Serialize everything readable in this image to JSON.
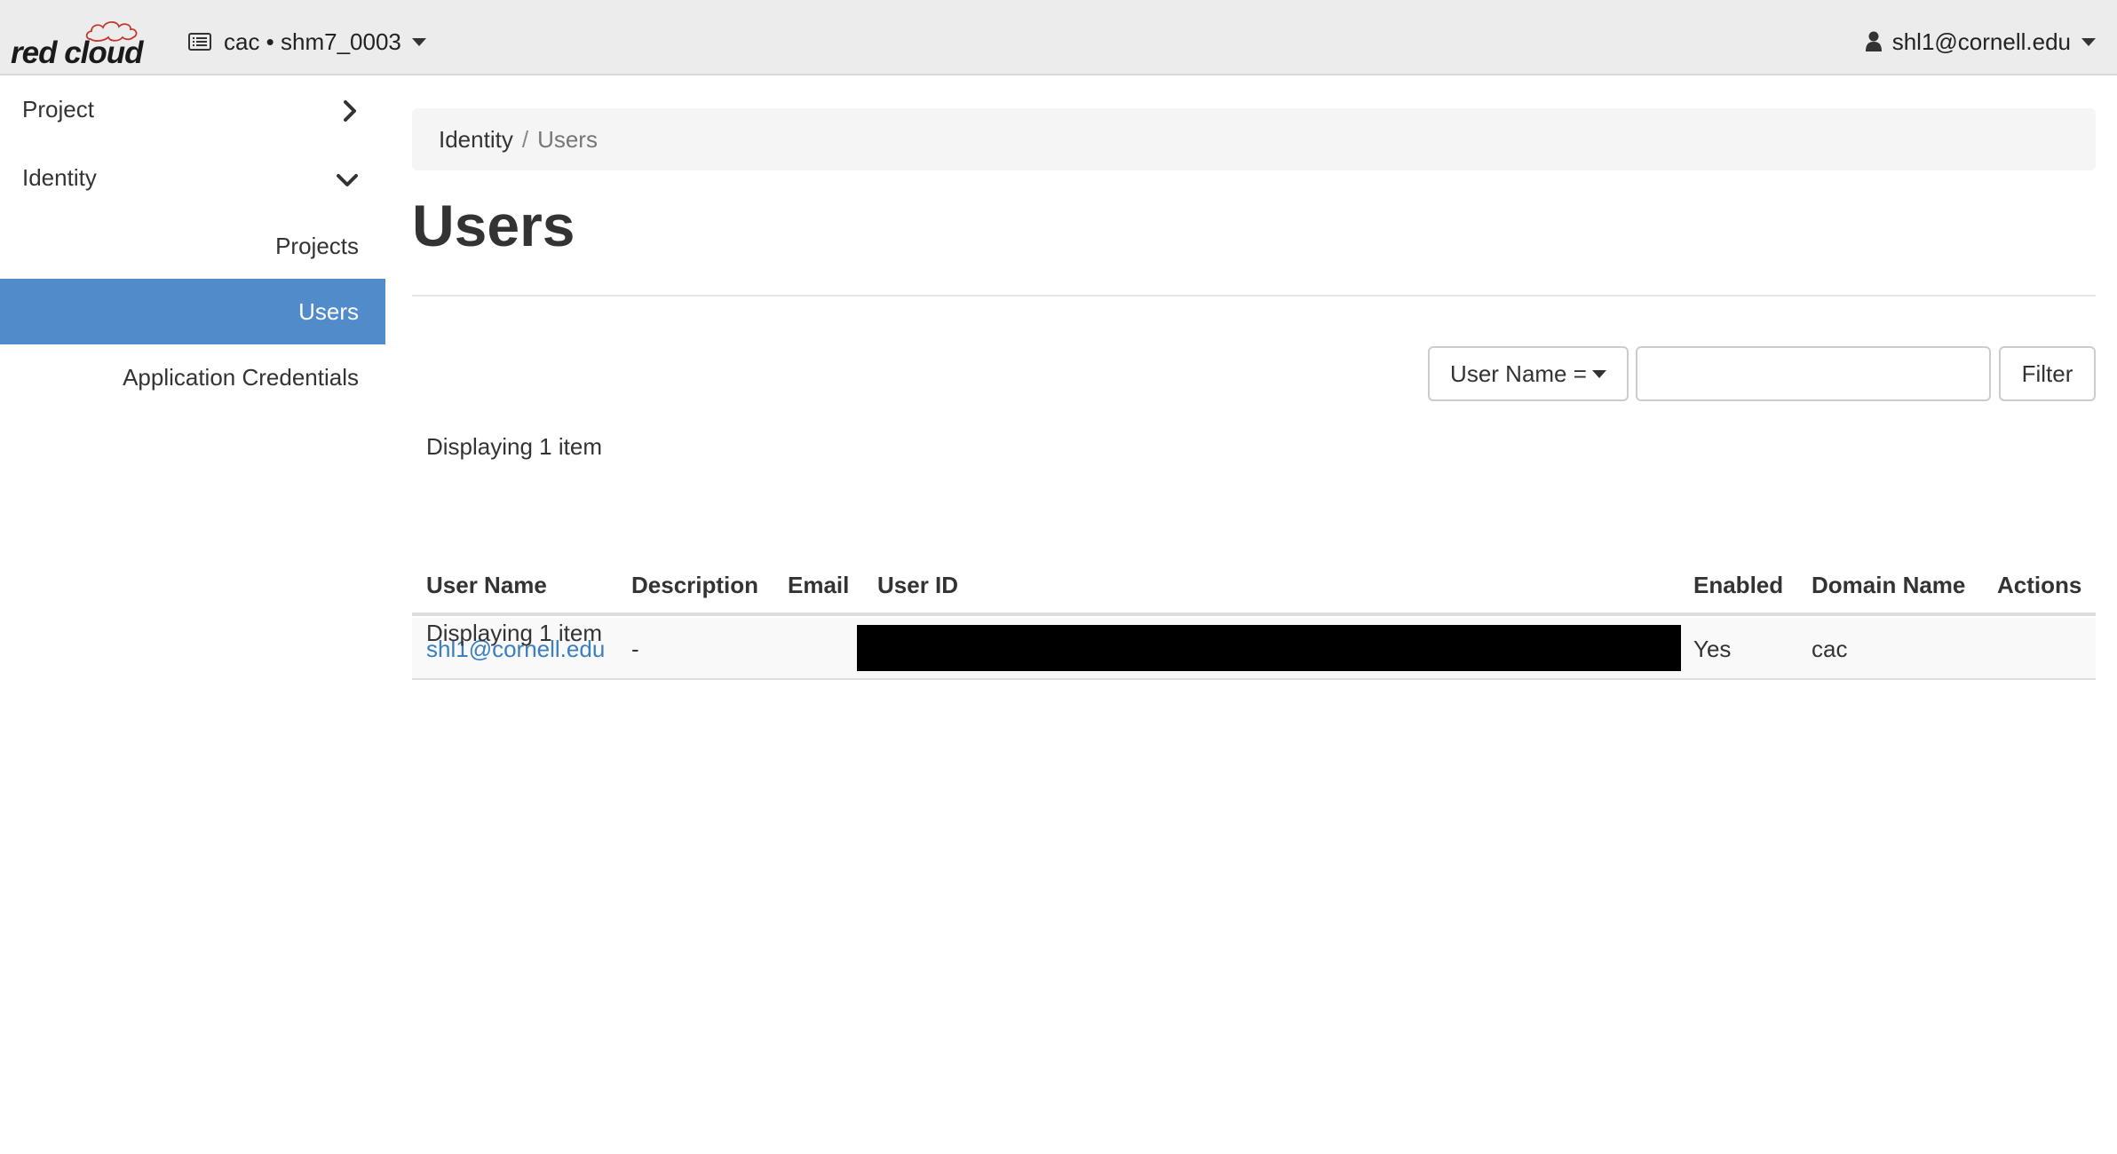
{
  "brand": {
    "logo_text": "red cloud"
  },
  "navbar": {
    "project_picker_label": "cac • shm7_0003",
    "user_menu_label": "shl1@cornell.edu"
  },
  "sidebar": {
    "sections": [
      {
        "label": "Project",
        "chevron": "chevron-right-icon"
      },
      {
        "label": "Identity",
        "chevron": "chevron-down-icon"
      }
    ],
    "items": [
      {
        "label": "Projects",
        "active": false
      },
      {
        "label": "Users",
        "active": true
      },
      {
        "label": "Application Credentials",
        "active": false
      }
    ]
  },
  "breadcrumb": {
    "parent": "Identity",
    "separator": "/",
    "current": "Users"
  },
  "page": {
    "title": "Users"
  },
  "filter": {
    "field_label": "User Name =",
    "input_value": "",
    "button_label": "Filter"
  },
  "table": {
    "count_text_top": "Displaying 1 item",
    "count_text_bottom": "Displaying 1 item",
    "columns": [
      "User Name",
      "Description",
      "Email",
      "User ID",
      "Enabled",
      "Domain Name",
      "Actions"
    ],
    "rows": [
      {
        "user_name": "shl1@cornell.edu",
        "description": "-",
        "email": "",
        "user_id_redacted": true,
        "enabled": "Yes",
        "domain_name": "cac",
        "actions": ""
      }
    ]
  },
  "colors": {
    "navbar_bg": "#ececec",
    "active_nav_bg": "#528bc9",
    "link": "#3a7fc1",
    "logo_cloud": "#c0392b"
  }
}
